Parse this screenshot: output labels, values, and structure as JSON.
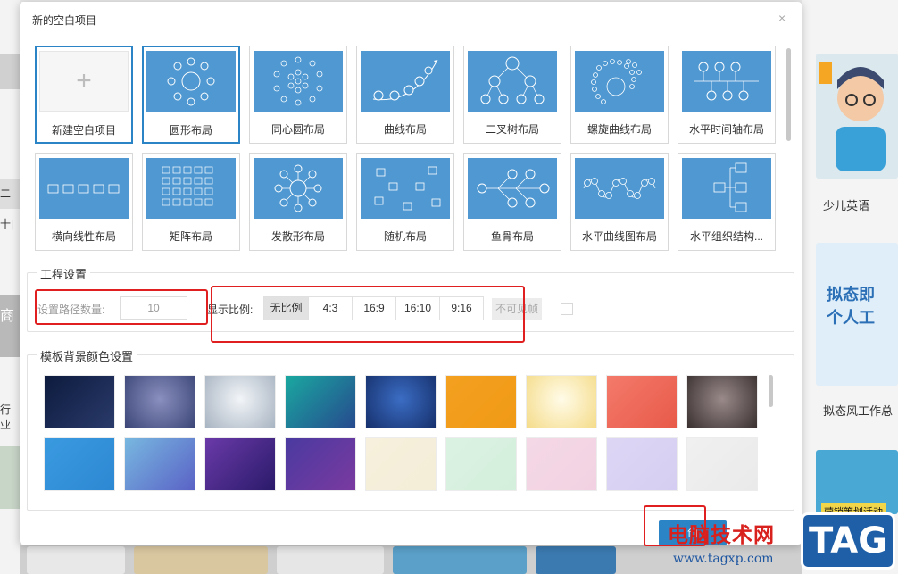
{
  "dialog": {
    "title": "新的空白项目",
    "close_glyph": "×"
  },
  "layouts": [
    {
      "label": "新建空白项目",
      "icon": "plus-icon",
      "selected": true
    },
    {
      "label": "圆形布局",
      "icon": "circle-layout-icon",
      "selected": true
    },
    {
      "label": "同心圆布局",
      "icon": "concentric-layout-icon"
    },
    {
      "label": "曲线布局",
      "icon": "curve-layout-icon"
    },
    {
      "label": "二叉树布局",
      "icon": "binary-tree-layout-icon"
    },
    {
      "label": "螺旋曲线布局",
      "icon": "spiral-layout-icon"
    },
    {
      "label": "水平时间轴布局",
      "icon": "timeline-layout-icon"
    },
    {
      "label": "横向线性布局",
      "icon": "linear-layout-icon"
    },
    {
      "label": "矩阵布局",
      "icon": "matrix-layout-icon"
    },
    {
      "label": "发散形布局",
      "icon": "radial-layout-icon"
    },
    {
      "label": "随机布局",
      "icon": "random-layout-icon"
    },
    {
      "label": "鱼骨布局",
      "icon": "fishbone-layout-icon"
    },
    {
      "label": "水平曲线图布局",
      "icon": "wave-layout-icon"
    },
    {
      "label": "水平组织结构...",
      "icon": "org-layout-icon"
    }
  ],
  "project": {
    "section_title": "工程设置",
    "path_count_label": "设置路径数量:",
    "path_count_value": "10",
    "ratio_label": "显示比例:",
    "ratios": [
      "无比例",
      "4:3",
      "16:9",
      "16:10",
      "9:16"
    ],
    "active_ratio": "无比例",
    "frame_label": "不可见帧"
  },
  "bg_colors": {
    "section_title": "模板背景颜色设置",
    "swatches": [
      {
        "from": "#0d1b3e",
        "to": "#2a3a6a",
        "kind": "linear"
      },
      {
        "from": "#8a90c0",
        "to": "#3b4677",
        "kind": "radial"
      },
      {
        "from": "#f2f5f8",
        "to": "#a8b4c2",
        "kind": "radial"
      },
      {
        "from": "#1aa8a0",
        "to": "#264a8e",
        "kind": "linear"
      },
      {
        "from": "#3b6dc4",
        "to": "#16306c",
        "kind": "radial"
      },
      {
        "from": "#f4a020",
        "to": "#f09a16",
        "kind": "linear"
      },
      {
        "from": "#fffbe8",
        "to": "#f5dc8a",
        "kind": "radial"
      },
      {
        "from": "#f47a6a",
        "to": "#e85a4a",
        "kind": "linear"
      },
      {
        "from": "#9a8a8a",
        "to": "#3a3030",
        "kind": "radial"
      },
      {
        "from": "#3a9ae0",
        "to": "#2c88d2",
        "kind": "linear"
      },
      {
        "from": "#78b8e0",
        "to": "#5a62c6",
        "kind": "linear"
      },
      {
        "from": "#6a3aa8",
        "to": "#2a1a6a",
        "kind": "linear"
      },
      {
        "from": "#4a3aa0",
        "to": "#7a3aa0",
        "kind": "linear"
      },
      {
        "from": "#f6f0dc",
        "to": "#f4edd8",
        "kind": "linear"
      },
      {
        "from": "#daf2e2",
        "to": "#d4efdc",
        "kind": "linear"
      },
      {
        "from": "#f4d8e6",
        "to": "#f2d2e2",
        "kind": "linear"
      },
      {
        "from": "#ddd6f4",
        "to": "#d6cef2",
        "kind": "linear"
      },
      {
        "from": "#f0f0f0",
        "to": "#eaeaea",
        "kind": "linear"
      }
    ]
  },
  "create_button": "创",
  "background": {
    "cards": [
      "少儿英语",
      "拟态风工作总"
    ],
    "card2_big1": "拟态即",
    "card2_big2": "个人工",
    "card3_text": "营销策划活动",
    "left_text1": "二十|",
    "left_text2": "商",
    "left_text3": "行业"
  },
  "watermark": {
    "cn": "电脑技术网",
    "url": "www.tagxp.com",
    "tag": "TAG"
  },
  "colors": {
    "accent": "#2b84c6",
    "thumb_blue": "#4f98d1",
    "annotation_red": "#e02020"
  }
}
